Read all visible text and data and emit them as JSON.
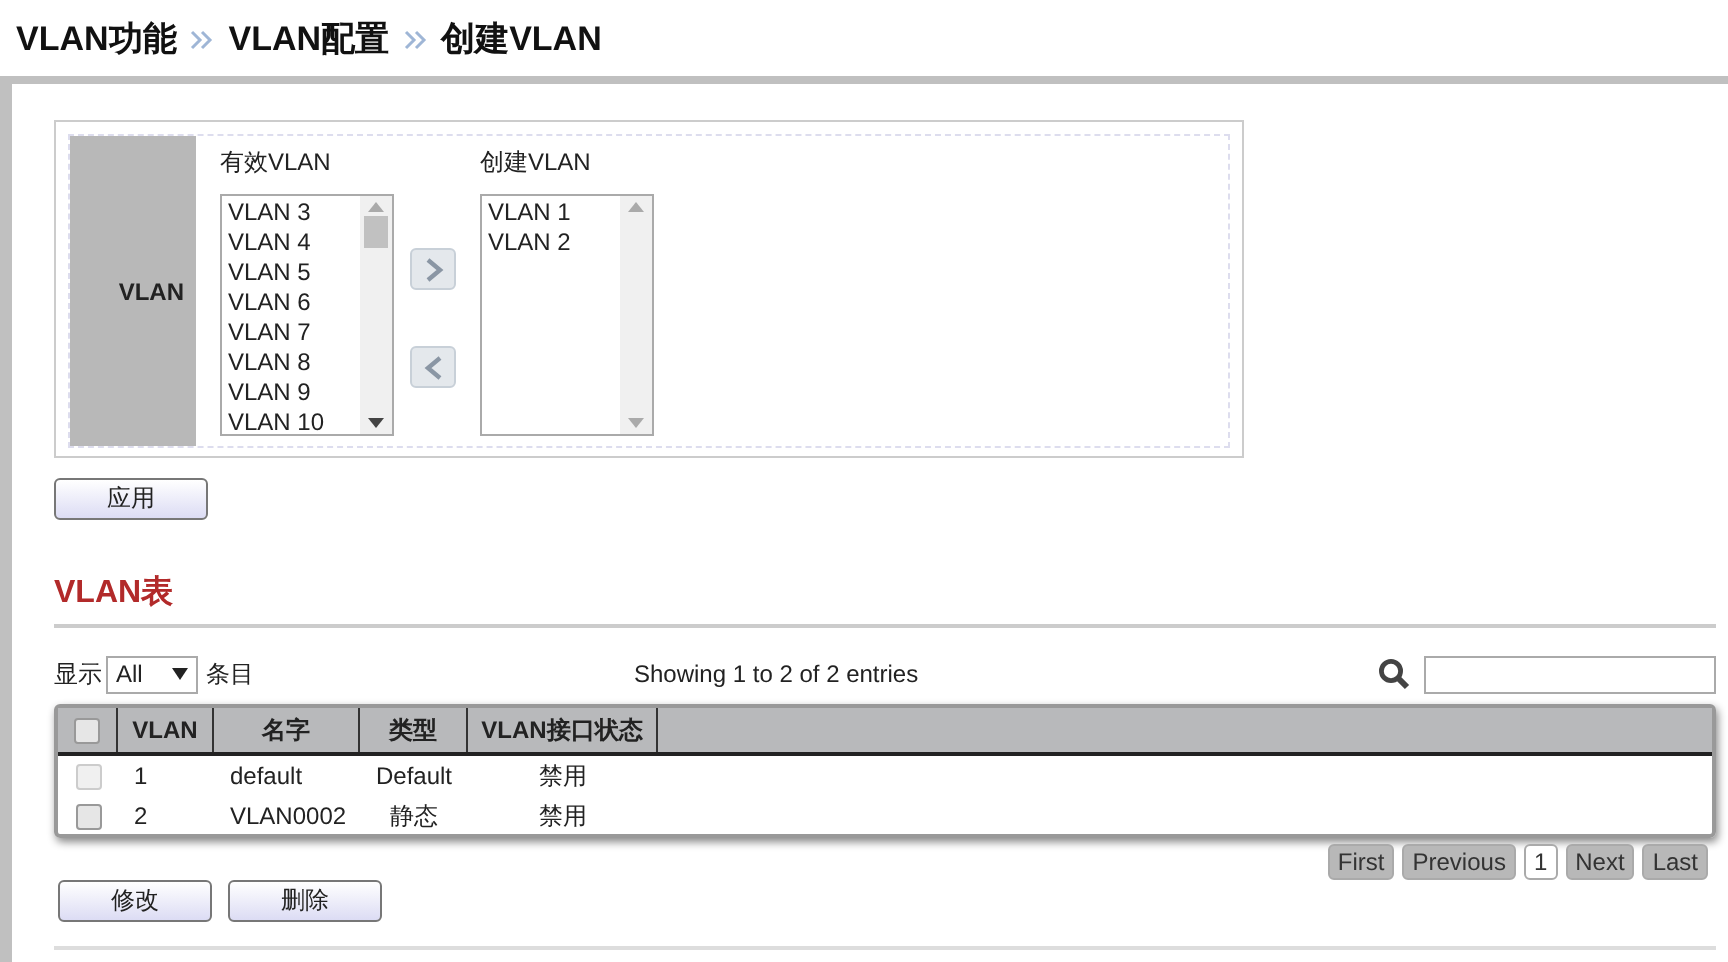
{
  "breadcrumb": [
    "VLAN功能",
    "VLAN配置",
    "创建VLAN"
  ],
  "vlan_panel": {
    "label": "VLAN",
    "available": {
      "title": "有效VLAN",
      "items": [
        "VLAN 3",
        "VLAN 4",
        "VLAN 5",
        "VLAN 6",
        "VLAN 7",
        "VLAN 8",
        "VLAN 9",
        "VLAN 10"
      ]
    },
    "created": {
      "title": "创建VLAN",
      "items": [
        "VLAN 1",
        "VLAN 2"
      ]
    },
    "apply_button": "应用"
  },
  "table_section": {
    "title": "VLAN表",
    "length": {
      "prefix": "显示",
      "value": "All",
      "suffix": "条目"
    },
    "info": "Showing 1 to 2 of 2 entries",
    "select_all": {
      "checked": false
    },
    "columns": [
      "VLAN",
      "名字",
      "类型",
      "VLAN接口状态"
    ],
    "rows": [
      {
        "checked": false,
        "disabled": true,
        "cells": [
          "1",
          "default",
          "Default",
          "禁用"
        ]
      },
      {
        "checked": false,
        "disabled": false,
        "cells": [
          "2",
          "VLAN0002",
          "静态",
          "禁用"
        ]
      }
    ],
    "pagination": [
      {
        "label": "First",
        "selected": false
      },
      {
        "label": "Previous",
        "selected": false
      },
      {
        "label": "1",
        "selected": true
      },
      {
        "label": "Next",
        "selected": false
      },
      {
        "label": "Last",
        "selected": false
      }
    ],
    "buttons": [
      "修改",
      "删除"
    ]
  }
}
